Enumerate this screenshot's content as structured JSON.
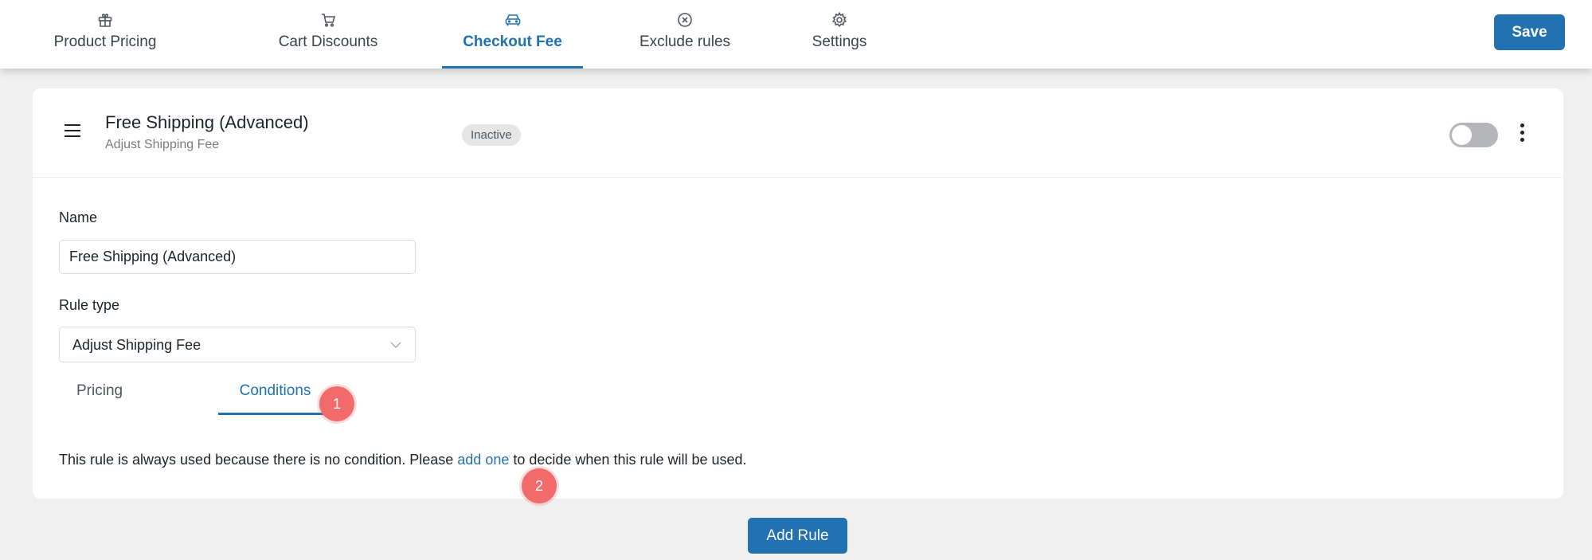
{
  "nav": {
    "tabs": [
      {
        "label": "Product Pricing",
        "icon": "gift-icon"
      },
      {
        "label": "Cart Discounts",
        "icon": "cart-icon"
      },
      {
        "label": "Checkout Fee",
        "icon": "car-icon",
        "active": true
      },
      {
        "label": "Exclude rules",
        "icon": "circle-x-icon"
      },
      {
        "label": "Settings",
        "icon": "gear-icon"
      }
    ],
    "save_label": "Save"
  },
  "rule": {
    "title": "Free Shipping (Advanced)",
    "subtitle": "Adjust Shipping Fee",
    "status": "Inactive",
    "enabled": false,
    "name_label": "Name",
    "name_value": "Free Shipping (Advanced)",
    "type_label": "Rule type",
    "type_value": "Adjust Shipping Fee",
    "tabs": [
      {
        "label": "Pricing"
      },
      {
        "label": "Conditions",
        "active": true
      }
    ],
    "condition_message": {
      "before": "This rule is always used because there is no condition. Please ",
      "link": "add one",
      "after": " to decide when this rule will be used."
    }
  },
  "markers": [
    "1",
    "2"
  ],
  "add_rule_label": "Add Rule",
  "colors": {
    "accent": "#2271b1",
    "marker": "#f26b6b",
    "background": "#f0f0f1",
    "badge_bg": "#e6e6e6"
  }
}
